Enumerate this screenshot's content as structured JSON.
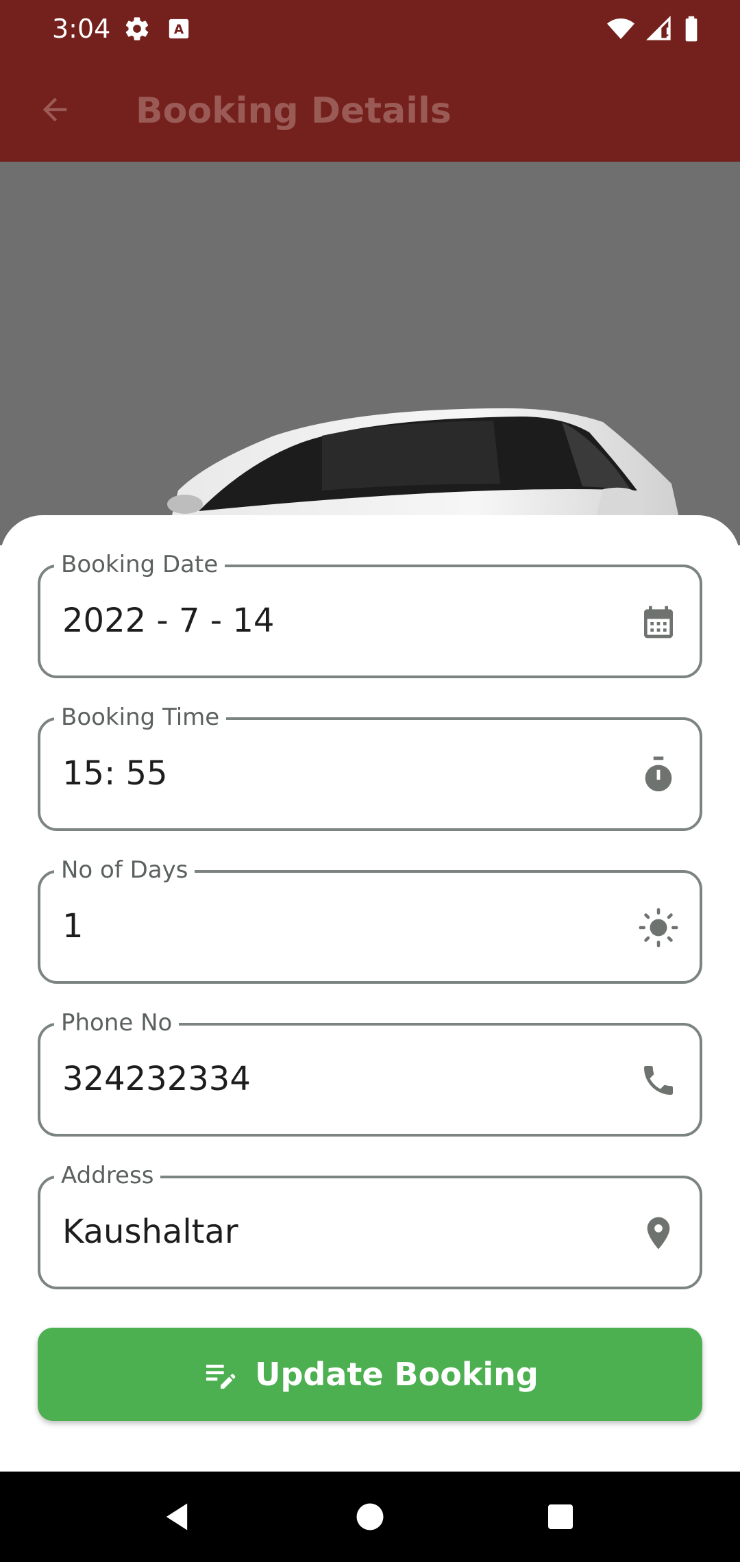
{
  "status_bar": {
    "time": "3:04",
    "icons": [
      "gear-icon",
      "keyboard-icon",
      "wifi-icon",
      "signal-icon",
      "battery-icon"
    ]
  },
  "app_bar": {
    "title": "Booking Details",
    "back_icon": "arrow-left-icon"
  },
  "hero": {
    "image": "car-image"
  },
  "form": {
    "fields": [
      {
        "label": "Booking Date",
        "value": "2022 - 7 - 14",
        "icon": "calendar-icon"
      },
      {
        "label": "Booking Time",
        "value": "15: 55",
        "icon": "timer-icon"
      },
      {
        "label": "No of Days",
        "value": "1",
        "icon": "sun-icon"
      },
      {
        "label": "Phone No",
        "value": "324232334",
        "icon": "phone-icon"
      },
      {
        "label": "Address",
        "value": "Kaushaltar",
        "icon": "location-pin-icon"
      }
    ]
  },
  "update_button": {
    "label": "Update Booking",
    "icon": "edit-note-icon"
  },
  "colors": {
    "app_bar": "#74201c",
    "button": "#4caf50",
    "outline": "#7c8481"
  },
  "nav_bar": {
    "icons": [
      "back-triangle-icon",
      "home-circle-icon",
      "recents-square-icon"
    ]
  }
}
